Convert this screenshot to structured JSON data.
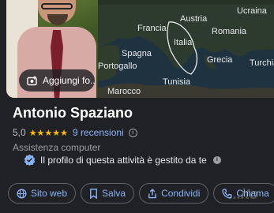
{
  "photo": {
    "add_photo_label": "Aggiungi fo..."
  },
  "map": {
    "labels": {
      "austria": "Austria",
      "ucraina": "Ucraina",
      "francia": "Francia",
      "romania": "Romania",
      "italia": "Italia",
      "spagna": "Spagna",
      "portogallo": "Portogallo",
      "grecia": "Grecia",
      "turchia": "Turchia",
      "tunisia": "Tunisia",
      "marocco": "Marocco"
    }
  },
  "business": {
    "name": "Antonio Spaziano",
    "rating": "5,0",
    "stars": "★★★★★",
    "reviews": "9 recensioni",
    "category": "Assistenza computer",
    "managed_text": "Il profilo di questa attività è gestito da te"
  },
  "actions": {
    "website": "Sito web",
    "save": "Salva",
    "share": "Condividi",
    "call": "Chiama"
  },
  "watermark": "...ito",
  "colors": {
    "accent": "#8ab4f8",
    "star": "#fbbc04",
    "verified": "#8ab4f8",
    "background": "#202124"
  }
}
